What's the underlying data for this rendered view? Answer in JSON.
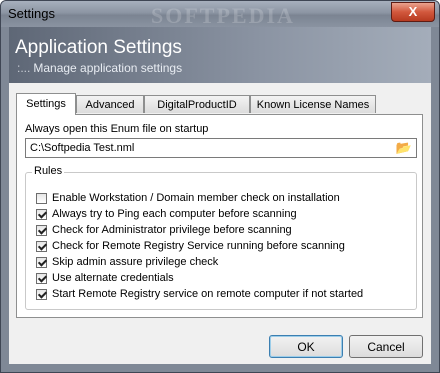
{
  "window": {
    "title": "Settings",
    "watermark": "SOFTPEDIA",
    "close_label": "X"
  },
  "banner": {
    "heading": "Application Settings",
    "subheading": "Manage application settings",
    "dots": ":..."
  },
  "tabs": [
    {
      "label": "Settings",
      "active": true
    },
    {
      "label": "Advanced",
      "active": false
    },
    {
      "label": "DigitalProductID",
      "active": false
    },
    {
      "label": "Known License Names",
      "active": false
    }
  ],
  "settings": {
    "open_label": "Always open this Enum file on startup",
    "path_value": "C:\\Softpedia Test.nml",
    "browse_icon": "folder-open-icon",
    "rules_label": "Rules",
    "rules": [
      {
        "label": "Enable Workstation / Domain member check on installation",
        "checked": false
      },
      {
        "label": "Always try to Ping each computer before scanning",
        "checked": true
      },
      {
        "label": "Check for Administrator privilege before scanning",
        "checked": true
      },
      {
        "label": "Check for Remote Registry Service running before scanning",
        "checked": true
      },
      {
        "label": "Skip admin assure privilege check",
        "checked": true
      },
      {
        "label": "Use alternate credentials",
        "checked": true
      },
      {
        "label": "Start Remote Registry service on remote computer if not started",
        "checked": true
      }
    ]
  },
  "buttons": {
    "ok": "OK",
    "cancel": "Cancel"
  }
}
